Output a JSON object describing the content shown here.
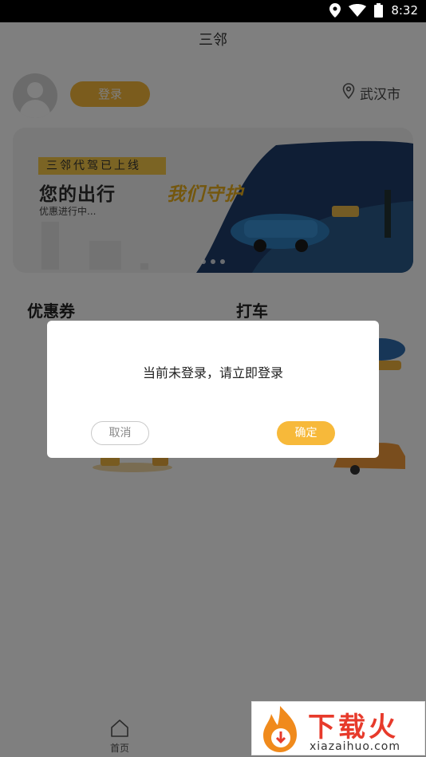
{
  "status_bar": {
    "time": "8:32"
  },
  "header": {
    "title": "三邻"
  },
  "profile": {
    "login_label": "登录",
    "city": "武汉市"
  },
  "banner": {
    "tag": "三邻代驾已上线",
    "slogan_left": "您的出行",
    "slogan_right": "我们守护",
    "promo": "优惠进行中..."
  },
  "cards": [
    {
      "title": "优惠券"
    },
    {
      "title": "打车"
    }
  ],
  "bottom_nav": {
    "home_label": "首页"
  },
  "dialog": {
    "message": "当前未登录，请立即登录",
    "cancel_label": "取消",
    "confirm_label": "确定"
  },
  "watermark": {
    "brand": "下载火",
    "url": "xiazaihuo.com"
  },
  "colors": {
    "accent": "#f7b93a",
    "mask": "rgba(0,0,0,0.5)"
  }
}
